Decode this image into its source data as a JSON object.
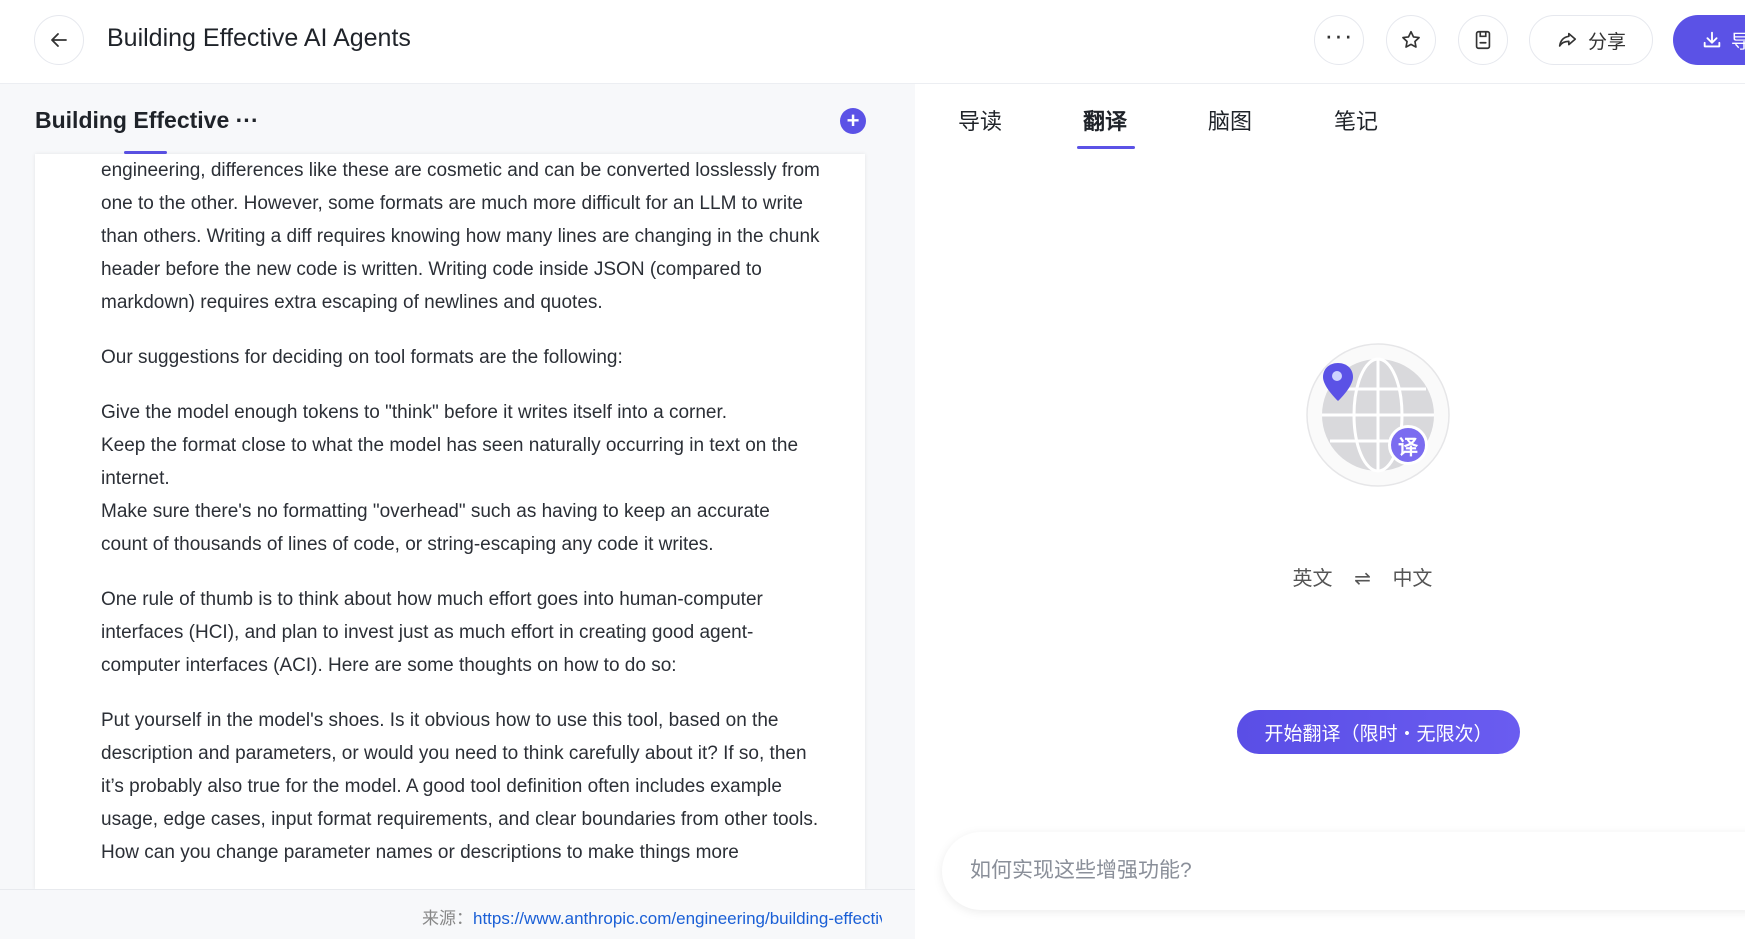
{
  "header": {
    "title": "Building Effective AI Agents",
    "share_label": "分享",
    "download_label": "导出",
    "more_glyph": "···"
  },
  "left": {
    "tab_label": "Building Effective ···",
    "add_glyph": "+",
    "paragraphs": [
      "engineering, differences like these are cosmetic and can be converted losslessly from one to the other. However, some formats are much more difficult for an LLM to write than others. Writing a diff requires knowing how many lines are changing in the chunk header before the new code is written. Writing code inside JSON (compared to markdown) requires extra escaping of newlines and quotes.",
      "Our suggestions for deciding on tool formats are the following:",
      "Give the model enough tokens to \"think\" before it writes itself into a corner.",
      "Keep the format close to what the model has seen naturally occurring in text on the internet.",
      "Make sure there's no formatting \"overhead\" such as having to keep an accurate count of thousands of lines of code, or string-escaping any code it writes.",
      "One rule of thumb is to think about how much effort goes into human-computer interfaces (HCI), and plan to invest just as much effort in creating good agent-computer interfaces (ACI). Here are some thoughts on how to do so:",
      "Put yourself in the model's shoes. Is it obvious how to use this tool, based on the description and parameters, or would you need to think carefully about it? If so, then it’s probably also true for the model. A good tool definition often includes example usage, edge cases, input format requirements, and clear boundaries from other tools.",
      "How can you change parameter names or descriptions to make things more"
    ],
    "source_label": "来源：",
    "source_url": "https://www.anthropic.com/engineering/building-effective-agents"
  },
  "right": {
    "tabs": [
      {
        "label": "导读"
      },
      {
        "label": "翻译"
      },
      {
        "label": "脑图"
      },
      {
        "label": "笔记"
      }
    ],
    "active_tab": 1,
    "globe_badge": "译",
    "lang_from": "英文",
    "swap_glyph": "⇌",
    "lang_to": "中文",
    "start_button": "开始翻译（限时・无限次）",
    "chat_placeholder": "如何实现这些增强功能?"
  },
  "colors": {
    "accent": "#5b52e6",
    "link": "#1a5fd6"
  }
}
